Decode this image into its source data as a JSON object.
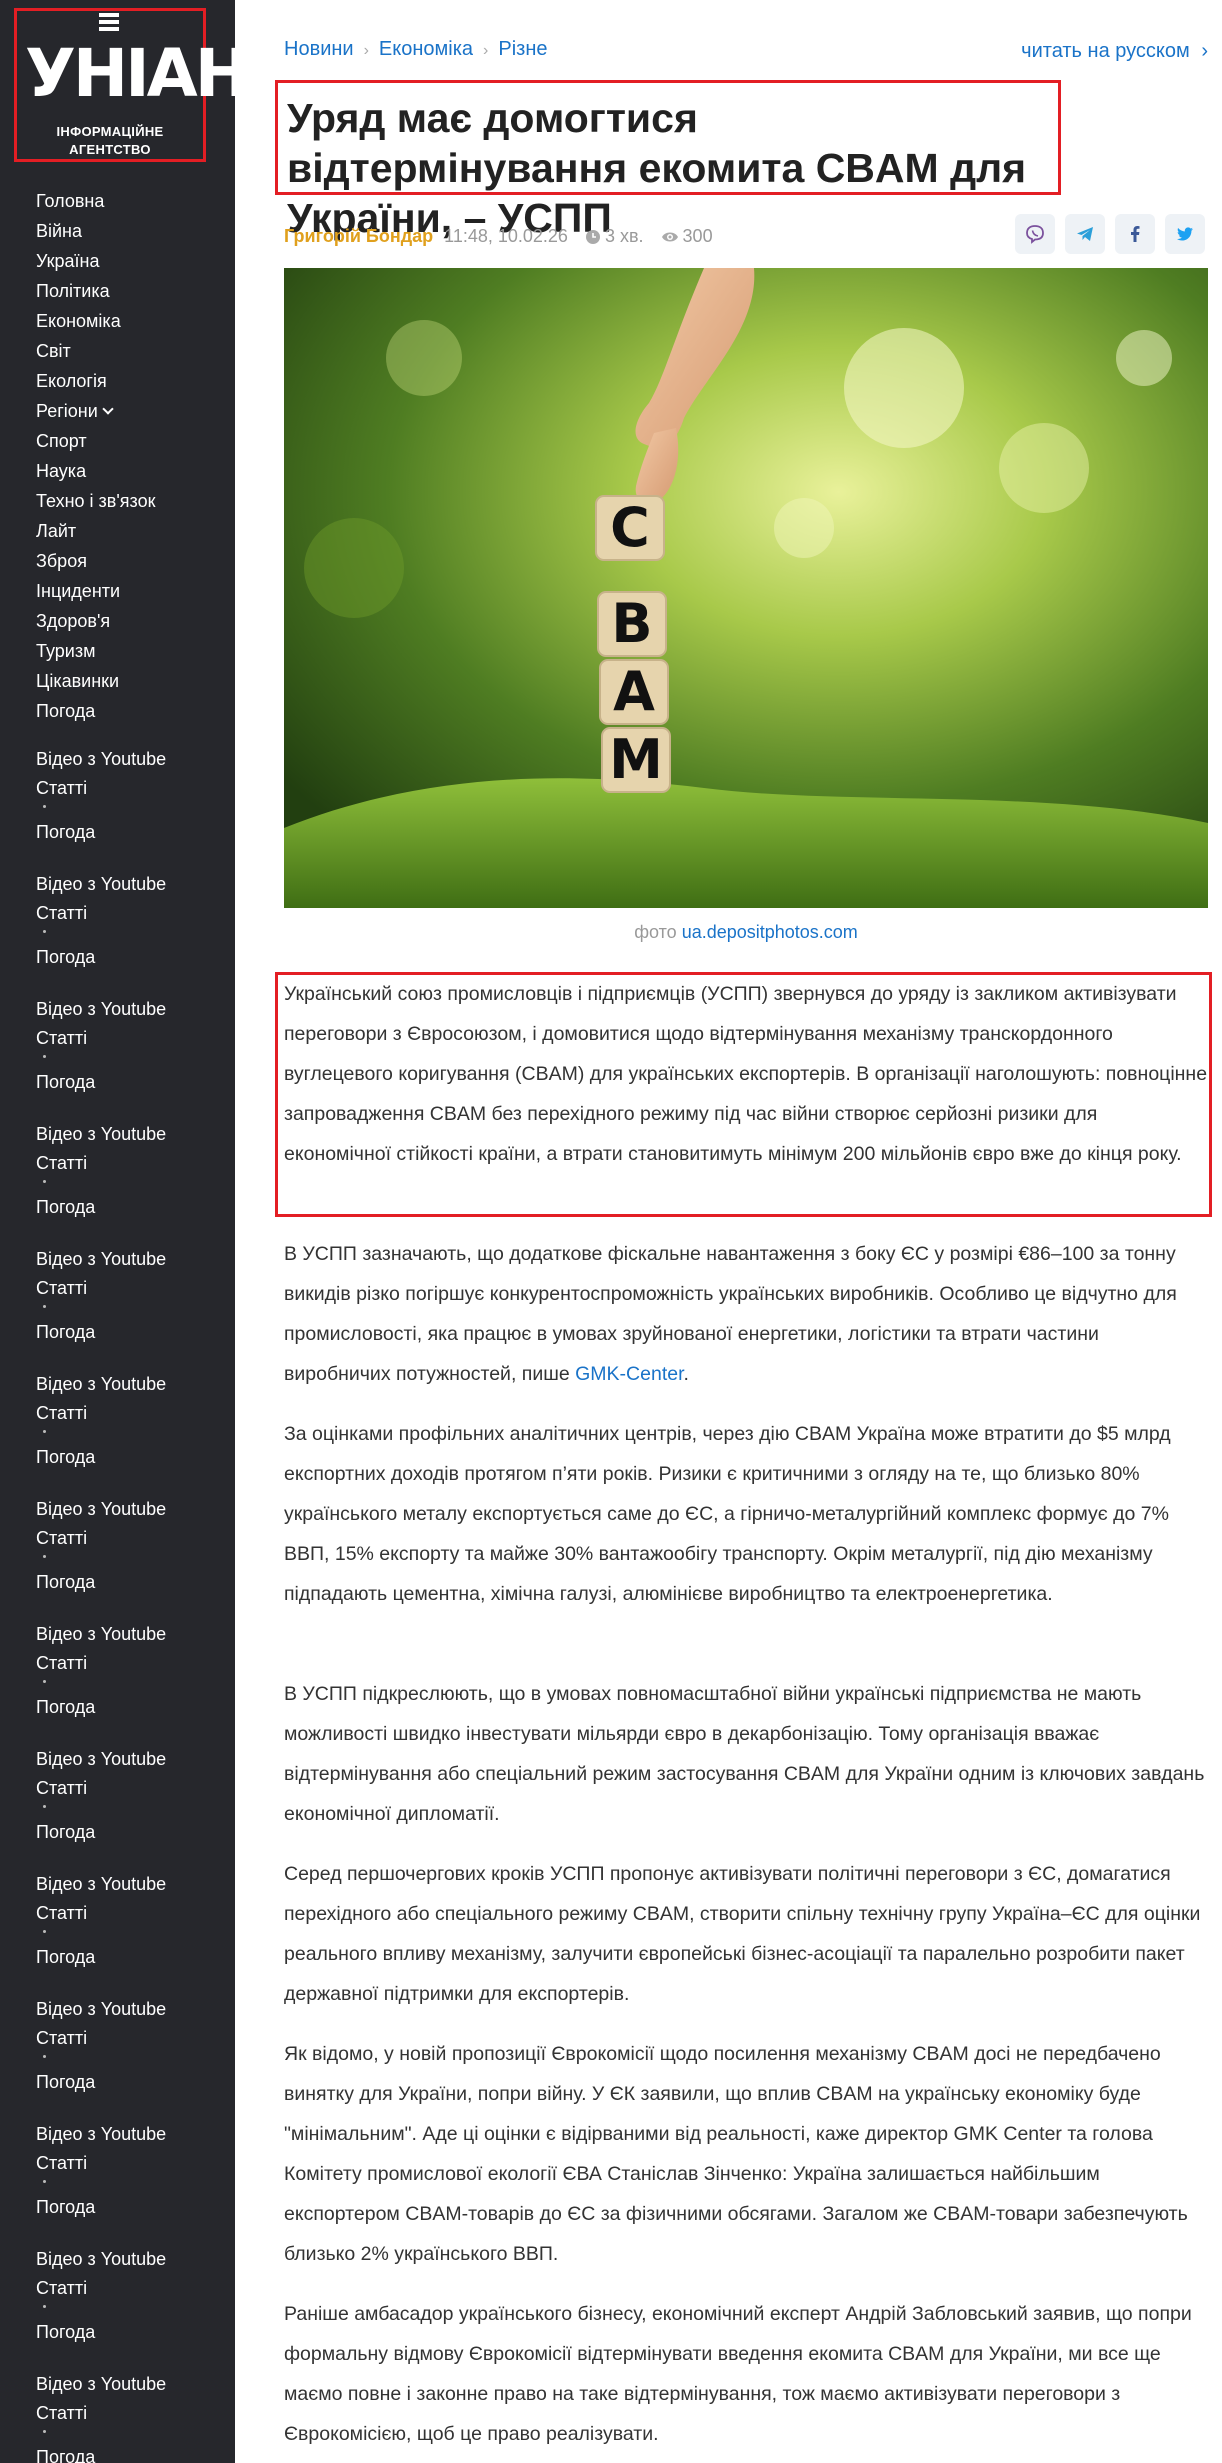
{
  "logo": {
    "name": "УНІАН",
    "sub_line1": "ІНФОРМАЦІЙНЕ",
    "sub_line2": "АГЕНТСТВО"
  },
  "nav": {
    "items": [
      "Головна",
      "Війна",
      "Україна",
      "Політика",
      "Економіка",
      "Світ",
      "Екологія",
      "Регіони",
      "Спорт",
      "Наука",
      "Техно і зв'язок",
      "Лайт",
      "Зброя",
      "Інциденти",
      "Здоров'я",
      "Туризм",
      "Цікавинки",
      "Погода"
    ],
    "extra": {
      "video": "Відео з Youtube",
      "articles": "Статті",
      "weather": "Погода"
    }
  },
  "breadcrumbs": [
    "Новини",
    "Економіка",
    "Різне"
  ],
  "lang_link": "читать на русском",
  "article": {
    "title": "Уряд має домогтися відтермінування екомита CBAM для України, – УСПП",
    "author": "Григорій Бондар",
    "datetime": "11:48, 10.02.26",
    "read_time": "3 хв.",
    "views": "300",
    "hero_letters": [
      "C",
      "B",
      "A",
      "M"
    ],
    "photo_credit_prefix": "фото",
    "photo_credit_source": "ua.depositphotos.com",
    "lead": "Український союз промисловців і підприємців (УСПП) звернувся до уряду із закликом активізувати переговори з Євросоюзом, і домовитися щодо відтермінування механізму транскордонного вуглецевого коригування (CBAM) для українських експортерів. В організації наголошують: повноцінне запровадження CBAM без перехідного режиму під час війни створює серйозні ризики для економічної стійкості країни, а втрати становитимуть мінімум 200 мільйонів євро вже до кінця року.",
    "p1": "В УСПП зазначають, що додаткове фіскальне навантаження з боку ЄС у розмірі €86–100 за тонну викидів різко погіршує конкурентоспроможність українських виробників. Особливо це відчутно для промисловості, яка працює в умовах зруйнованої енергетики, логістики та втрати частини виробничих потужностей, пише ",
    "p1_link": "GMK-Center",
    "p1_end": ".",
    "p2": "За оцінками профільних аналітичних центрів, через дію CBAM Україна може втратити до $5 млрд експортних доходів протягом п’яти років. Ризики є критичними з огляду на те, що близько 80% українського металу експортується саме до ЄС, а гірничо-металургійний комплекс формує до 7% ВВП, 15% експорту та майже 30% вантажообігу транспорту. Окрім металургії, під дію механізму підпадають цементна, хімічна галузі, алюмінієве виробництво та електроенергетика.",
    "p3": "В УСПП підкреслюють, що в умовах повномасштабної війни українські підприємства не мають можливості швидко інвестувати мільярди євро в декарбонізацію. Тому організація вважає відтермінування або спеціальний режим застосування CBAM для України одним із ключових завдань економічної дипломатії.",
    "p4": "Серед першочергових кроків УСПП пропонує активізувати політичні переговори з ЄС, домагатися перехідного або спеціального режиму CBAM, створити спільну технічну групу Україна–ЄС для оцінки реального впливу механізму, залучити європейські бізнес-асоціації та паралельно розробити пакет державної підтримки для експортерів.",
    "p5": "Як відомо, у новій пропозиції Єврокомісії щодо посилення механізму CBAM досі не передбачено винятку для України, попри війну. У ЄК заявили, що вплив CBAM на українську економіку буде \"мінімальним\". Аде ці оцінки є відірваними від реальності, каже директор GMK Center та голова Комітету промислової екології ЄВА Станіслав Зінченко: Україна залишається найбільшим експортером CBAM-товарів до ЄС за фізичними обсягами. Загалом же CBAM-товари забезпечують близько 2% українського ВВП.",
    "p6": "Раніше амбасадор українського бізнесу, економічний експерт Андрій Забловський заявив, що попри формальну відмову Єврокомісії відтермінувати введення екомита CBAM для України, ми все ще маємо повне і законне право на таке відтермінування, тож маємо активізувати переговори з Єврокомісією, щоб це право реалізувати."
  }
}
